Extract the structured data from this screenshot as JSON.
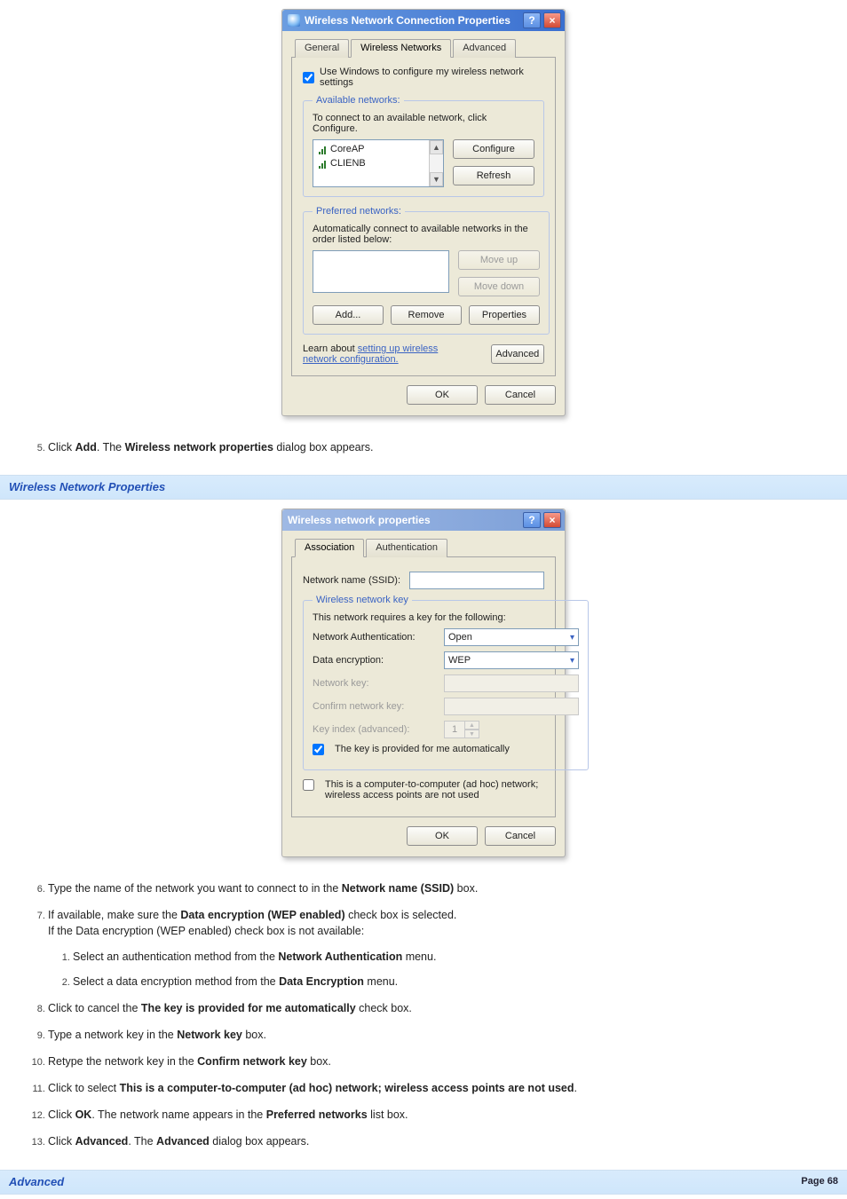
{
  "dlg1": {
    "title": "Wireless Network Connection Properties",
    "help": "?",
    "close": "×",
    "tabs": {
      "general": "General",
      "wireless": "Wireless Networks",
      "advanced": "Advanced"
    },
    "useWindows": "Use Windows to configure my wireless network settings",
    "available": {
      "legend": "Available networks:",
      "hint": "To connect to an available network, click Configure.",
      "items": [
        "CoreAP",
        "CLIENB"
      ],
      "configure": "Configure",
      "refresh": "Refresh"
    },
    "preferred": {
      "legend": "Preferred networks:",
      "hint": "Automatically connect to available networks in the order listed below:",
      "moveUp": "Move up",
      "moveDown": "Move down",
      "add": "Add...",
      "remove": "Remove",
      "properties": "Properties"
    },
    "learnPrefix": "Learn about ",
    "learnLink": "setting up wireless network configuration.",
    "advancedBtn": "Advanced",
    "ok": "OK",
    "cancel": "Cancel"
  },
  "step5": {
    "pre": "Click ",
    "b1": "Add",
    "mid": ". The ",
    "b2": "Wireless network properties",
    "post": " dialog box appears."
  },
  "bar1": "Wireless Network Properties",
  "dlg2": {
    "title": "Wireless network properties",
    "help": "?",
    "close": "×",
    "tabs": {
      "association": "Association",
      "authentication": "Authentication"
    },
    "ssidLabel": "Network name (SSID):",
    "key": {
      "legend": "Wireless network key",
      "hint": "This network requires a key for the following:",
      "authLabel": "Network Authentication:",
      "authVal": "Open",
      "encLabel": "Data encryption:",
      "encVal": "WEP",
      "keyLabel": "Network key:",
      "confirmLabel": "Confirm network key:",
      "indexLabel": "Key index (advanced):",
      "indexVal": "1",
      "autoKey": "The key is provided for me automatically"
    },
    "adhoc": "This is a computer-to-computer (ad hoc) network; wireless access points are not used",
    "ok": "OK",
    "cancel": "Cancel"
  },
  "step6": {
    "pre": "Type the name of the network you want to connect to in the ",
    "b1": "Network name (SSID)",
    "post": " box."
  },
  "step7": {
    "pre": "If available, make sure the ",
    "b1": "Data encryption (WEP enabled)",
    "mid": " check box is selected.",
    "line2": "If the Data encryption (WEP enabled) check box is not available:",
    "s1pre": "Select an authentication method from the ",
    "s1b": "Network Authentication",
    "s1post": " menu.",
    "s2pre": "Select a data encryption method from the ",
    "s2b": "Data Encryption",
    "s2post": " menu."
  },
  "step8": {
    "pre": "Click to cancel the ",
    "b1": "The key is provided for me automatically",
    "post": " check box."
  },
  "step9": {
    "pre": "Type a network key in the ",
    "b1": "Network key",
    "post": " box."
  },
  "step10": {
    "pre": "Retype the network key in the ",
    "b1": "Confirm network key",
    "post": " box."
  },
  "step11": {
    "pre": "Click to select ",
    "b1": "This is a computer-to-computer (ad hoc) network; wireless access points are not used",
    "post": "."
  },
  "step12": {
    "pre": "Click ",
    "b1": "OK",
    "mid": ". The network name appears in the ",
    "b2": "Preferred networks",
    "post": " list box."
  },
  "step13": {
    "pre": "Click ",
    "b1": "Advanced",
    "mid": ". The ",
    "b2": "Advanced",
    "post": " dialog box appears."
  },
  "bar2": "Advanced",
  "pageNum": "Page 68"
}
